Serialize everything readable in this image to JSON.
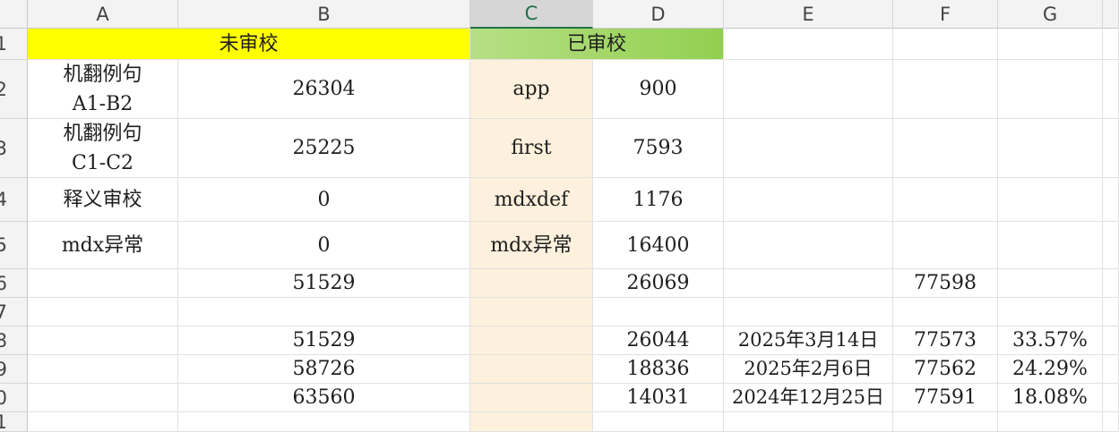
{
  "colors": {
    "yellow": "#ffff00",
    "green_light": "#b7df86",
    "green_dark": "#92d050",
    "col_c_fill": "#fdf0dc"
  },
  "columns": [
    "A",
    "B",
    "C",
    "D",
    "E",
    "F",
    "G"
  ],
  "rows": [
    "1",
    "2",
    "3",
    "4",
    "5",
    "6",
    "7",
    "8",
    "9",
    "10",
    "11"
  ],
  "cells": {
    "A1": "未审校",
    "C1": "已审校",
    "A2": "机翻例句\nA1-B2",
    "B2": "26304",
    "C2": "app",
    "D2": "900",
    "A3": "机翻例句\nC1-C2",
    "B3": "25225",
    "C3": "first",
    "D3": "7593",
    "A4": "释义审校",
    "B4": "0",
    "C4": "mdxdef",
    "D4": "1176",
    "A5": "mdx异常",
    "B5": "0",
    "C5": "mdx异常",
    "D5": "16400",
    "B6": "51529",
    "D6": "26069",
    "F6": "77598",
    "B8": "51529",
    "D8": "26044",
    "E8": "2025年3月14日",
    "F8": "77573",
    "G8": "33.57%",
    "B9": "58726",
    "D9": "18836",
    "E9": "2025年2月6日",
    "F9": "77562",
    "G9": "24.29%",
    "B10": "63560",
    "D10": "14031",
    "E10": "2024年12月25日",
    "F10": "77591",
    "G10": "18.08%"
  }
}
